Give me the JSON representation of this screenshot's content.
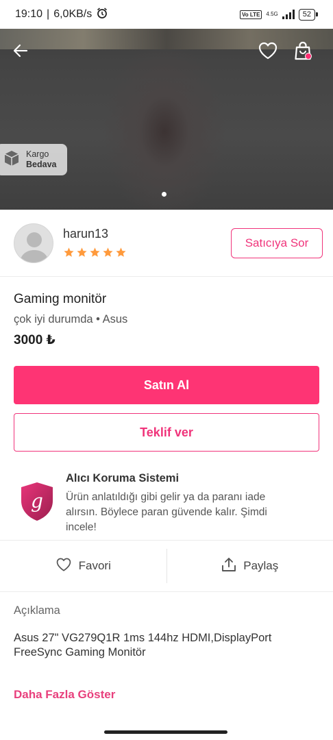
{
  "status_bar": {
    "time": "19:10",
    "speed": "6,0KB/s",
    "network_badge": "Vo LTE",
    "network_type": "4.5G",
    "battery": "52"
  },
  "hero": {
    "cargo_line1": "Kargo",
    "cargo_line2": "Bedava",
    "image_count": 1,
    "active_image": 1
  },
  "seller": {
    "name": "harun13",
    "rating": 5,
    "ask_button": "Satıcıya Sor"
  },
  "product": {
    "title": "Gaming monitör",
    "subtitle": "çok iyi durumda • Asus",
    "price": "3000 ₺"
  },
  "buttons": {
    "buy": "Satın Al",
    "offer": "Teklif ver"
  },
  "protection": {
    "title": "Alıcı Koruma Sistemi",
    "text": "Ürün anlatıldığı gibi gelir ya da paranı iade alırsın. Böylece paran güvende kalır. Şimdi incele!"
  },
  "actions": {
    "favorite": "Favori",
    "share": "Paylaş"
  },
  "description": {
    "label": "Açıklama",
    "text": "Asus 27\" VG279Q1R 1ms 144hz HDMI,DisplayPort FreeSync Gaming Monitör",
    "more": "Daha Fazla Göster"
  },
  "colors": {
    "accent": "#fe3474",
    "star": "#ff9a3c"
  }
}
